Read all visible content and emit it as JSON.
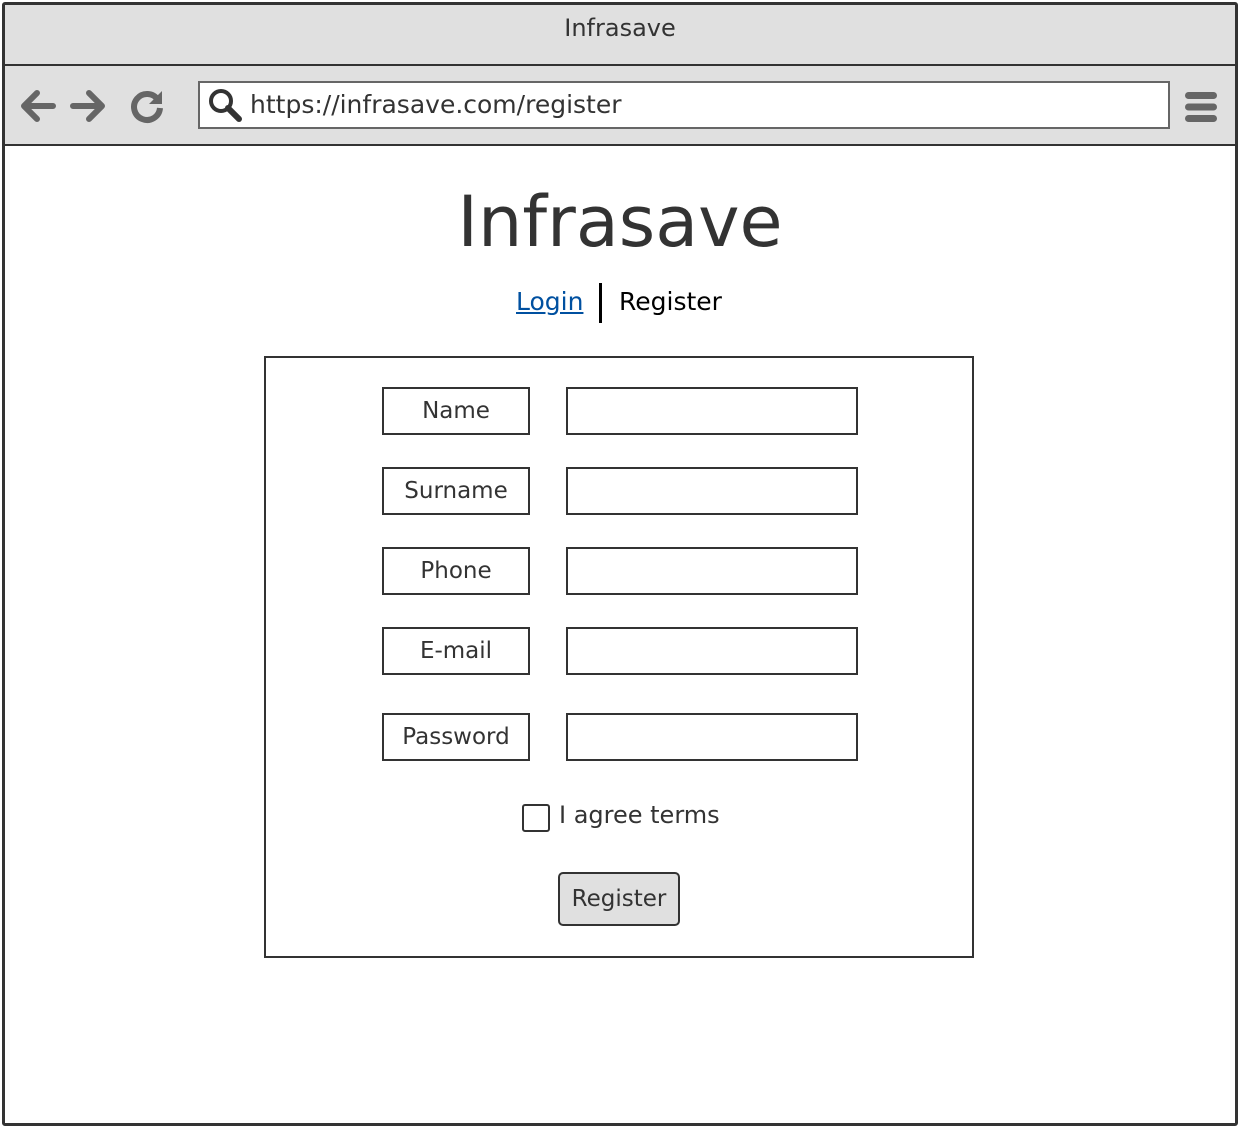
{
  "window": {
    "title": "Infrasave"
  },
  "browser": {
    "url": "https://infrasave.com/register",
    "icons": [
      "back-arrow-icon",
      "forward-arrow-icon",
      "reload-icon",
      "search-icon",
      "hamburger-menu-icon"
    ]
  },
  "page": {
    "title": "Infrasave",
    "tabs": {
      "login": "Login",
      "register": "Register"
    }
  },
  "form": {
    "fields": [
      {
        "label": "Name",
        "value": ""
      },
      {
        "label": "Surname",
        "value": ""
      },
      {
        "label": "Phone",
        "value": ""
      },
      {
        "label": "E-mail",
        "value": ""
      },
      {
        "label": "Password",
        "value": ""
      }
    ],
    "agree_label": "I agree terms",
    "agree_checked": false,
    "submit_label": "Register"
  },
  "colors": {
    "chrome": "#e0e0e0",
    "border": "#333333",
    "link": "#0050a0",
    "button": "#e0e0e0"
  }
}
